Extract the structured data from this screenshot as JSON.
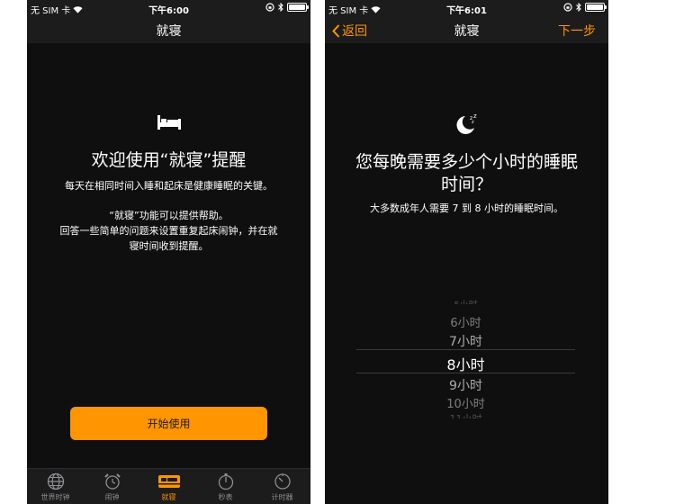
{
  "left": {
    "status": {
      "carrier": "无 SIM 卡",
      "time": "下午6:00"
    },
    "nav": {
      "title": "就寝"
    },
    "headline": "欢迎使用“就寝”提醒",
    "line1": "每天在相同时间入睡和起床是健康睡眠的关键。",
    "line2": "“就寝”功能可以提供帮助。",
    "line3": "回答一些简单的问题来设置重复起床闹钟，并在就",
    "line4": "寝时间收到提醒。",
    "start_button": "开始使用",
    "tabs": [
      {
        "label": "世界时钟",
        "icon": "globe-icon"
      },
      {
        "label": "闹钟",
        "icon": "alarm-clock-icon"
      },
      {
        "label": "就寝",
        "icon": "bed-icon"
      },
      {
        "label": "秒表",
        "icon": "stopwatch-icon"
      },
      {
        "label": "计时器",
        "icon": "timer-icon"
      }
    ],
    "active_tab": "就寝",
    "accent": "#ff9500"
  },
  "right": {
    "status": {
      "carrier": "无 SIM 卡",
      "time": "下午6:01"
    },
    "nav": {
      "back": "返回",
      "title": "就寝",
      "next": "下一步"
    },
    "headline1": "您每晚需要多少个小时的睡眠",
    "headline2": "时间？",
    "subtitle": "大多数成年人需要 7 到 8 小时的睡眠时间。",
    "picker": {
      "r1": "5小时",
      "r2": "6小时",
      "r3": "7小时",
      "selected": "8小时",
      "r5": "9小时",
      "r6": "10小时",
      "r7": "11小时"
    }
  }
}
